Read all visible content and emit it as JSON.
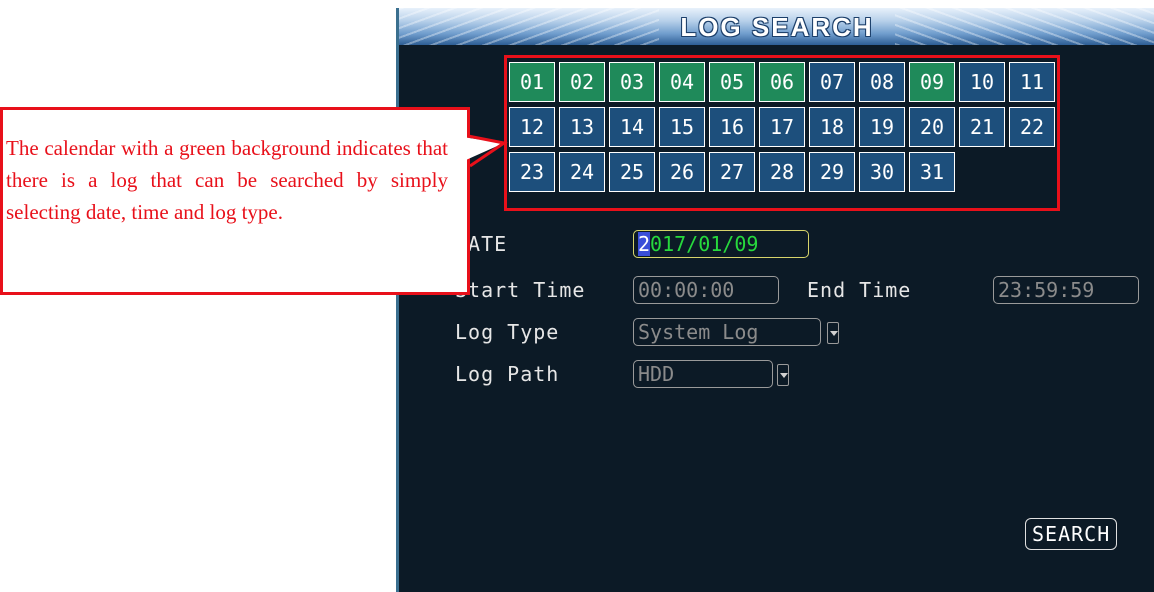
{
  "screen": {
    "title": "LOG SEARCH"
  },
  "calendar": {
    "days": [
      "01",
      "02",
      "03",
      "04",
      "05",
      "06",
      "07",
      "08",
      "09",
      "10",
      "11",
      "12",
      "13",
      "14",
      "15",
      "16",
      "17",
      "18",
      "19",
      "20",
      "21",
      "22",
      "23",
      "24",
      "25",
      "26",
      "27",
      "28",
      "29",
      "30",
      "31"
    ],
    "days_with_log": [
      "01",
      "02",
      "03",
      "04",
      "05",
      "06",
      "09"
    ],
    "log_color": "#1f8a5a",
    "no_log_color": "#1d4f7c"
  },
  "form": {
    "date_label": "DATE",
    "date_cursor": "2",
    "date_rest": "017/01/09",
    "start_time_label": "Start Time",
    "start_time_value": "00:00:00",
    "end_time_label": "End Time",
    "end_time_value": "23:59:59",
    "log_type_label": "Log Type",
    "log_type_value": "System Log",
    "log_path_label": "Log Path",
    "log_path_value": "HDD"
  },
  "search_button": "SEARCH",
  "annotation": {
    "text": "The calendar with a green background indicates that there is a log that can be searched by simply selecting date, time and log type.",
    "color": "#e8101a"
  }
}
